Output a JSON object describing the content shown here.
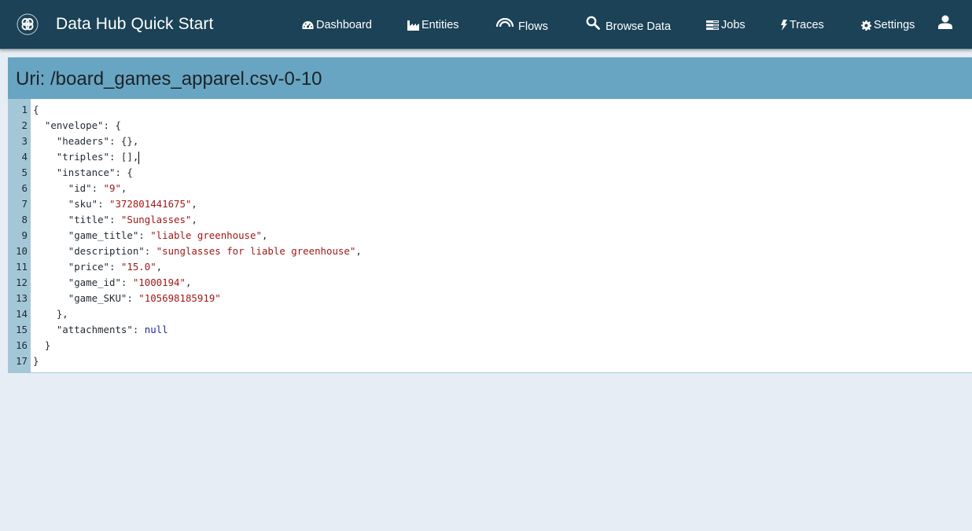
{
  "app": {
    "title": "Data Hub Quick Start",
    "logo_icon": "datahub-logo-icon"
  },
  "nav": {
    "items": [
      {
        "label": "Dashboard",
        "icon": "dashboard-gauge-icon"
      },
      {
        "label": "Entities",
        "icon": "entities-factory-icon"
      },
      {
        "label": "Flows",
        "icon": "flows-arc-icon"
      },
      {
        "label": "Browse Data",
        "icon": "search-icon"
      },
      {
        "label": "Jobs",
        "icon": "jobs-list-icon"
      },
      {
        "label": "Traces",
        "icon": "traces-bolt-icon"
      },
      {
        "label": "Settings",
        "icon": "gear-icon"
      }
    ],
    "user_icon": "user-icon"
  },
  "document": {
    "title": "Uri: /board_games_apparel.csv-0-10",
    "lines": [
      {
        "num": "1",
        "indent": "",
        "parts": [
          {
            "t": "{",
            "c": "k"
          }
        ]
      },
      {
        "num": "2",
        "indent": "  ",
        "parts": [
          {
            "t": "\"envelope\": {",
            "c": "k"
          }
        ]
      },
      {
        "num": "3",
        "indent": "    ",
        "parts": [
          {
            "t": "\"headers\": {},",
            "c": "k"
          }
        ]
      },
      {
        "num": "4",
        "indent": "    ",
        "parts": [
          {
            "t": "\"triples\": [],",
            "c": "k"
          }
        ],
        "cursor": true
      },
      {
        "num": "5",
        "indent": "    ",
        "parts": [
          {
            "t": "\"instance\": {",
            "c": "k"
          }
        ]
      },
      {
        "num": "6",
        "indent": "      ",
        "parts": [
          {
            "t": "\"id\": ",
            "c": "k"
          },
          {
            "t": "\"9\"",
            "c": "s"
          },
          {
            "t": ",",
            "c": "k"
          }
        ]
      },
      {
        "num": "7",
        "indent": "      ",
        "parts": [
          {
            "t": "\"sku\": ",
            "c": "k"
          },
          {
            "t": "\"372801441675\"",
            "c": "s"
          },
          {
            "t": ",",
            "c": "k"
          }
        ]
      },
      {
        "num": "8",
        "indent": "      ",
        "parts": [
          {
            "t": "\"title\": ",
            "c": "k"
          },
          {
            "t": "\"Sunglasses\"",
            "c": "s"
          },
          {
            "t": ",",
            "c": "k"
          }
        ]
      },
      {
        "num": "9",
        "indent": "      ",
        "parts": [
          {
            "t": "\"game_title\": ",
            "c": "k"
          },
          {
            "t": "\"liable greenhouse\"",
            "c": "s"
          },
          {
            "t": ",",
            "c": "k"
          }
        ]
      },
      {
        "num": "10",
        "indent": "      ",
        "parts": [
          {
            "t": "\"description\": ",
            "c": "k"
          },
          {
            "t": "\"sunglasses for liable greenhouse\"",
            "c": "s"
          },
          {
            "t": ",",
            "c": "k"
          }
        ]
      },
      {
        "num": "11",
        "indent": "      ",
        "parts": [
          {
            "t": "\"price\": ",
            "c": "k"
          },
          {
            "t": "\"15.0\"",
            "c": "s"
          },
          {
            "t": ",",
            "c": "k"
          }
        ]
      },
      {
        "num": "12",
        "indent": "      ",
        "parts": [
          {
            "t": "\"game_id\": ",
            "c": "k"
          },
          {
            "t": "\"1000194\"",
            "c": "s"
          },
          {
            "t": ",",
            "c": "k"
          }
        ]
      },
      {
        "num": "13",
        "indent": "      ",
        "parts": [
          {
            "t": "\"game_SKU\": ",
            "c": "k"
          },
          {
            "t": "\"105698185919\"",
            "c": "s"
          }
        ]
      },
      {
        "num": "14",
        "indent": "    ",
        "parts": [
          {
            "t": "},",
            "c": "k"
          }
        ]
      },
      {
        "num": "15",
        "indent": "    ",
        "parts": [
          {
            "t": "\"attachments\": ",
            "c": "k"
          },
          {
            "t": "null",
            "c": "n"
          }
        ]
      },
      {
        "num": "16",
        "indent": "  ",
        "parts": [
          {
            "t": "}",
            "c": "k"
          }
        ]
      },
      {
        "num": "17",
        "indent": "",
        "parts": [
          {
            "t": "}",
            "c": "k"
          }
        ]
      }
    ]
  },
  "colors": {
    "navbar": "#1b4257",
    "panel_header": "#68a5c2",
    "gutter": "#a4c7d8",
    "page_bg": "#e6edf4",
    "json_string": "#a11818",
    "json_null": "#1a2a9c"
  }
}
